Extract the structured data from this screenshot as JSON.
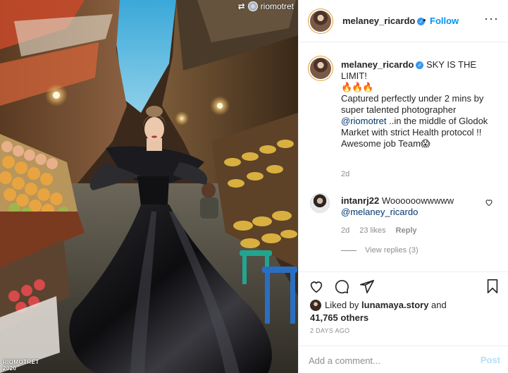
{
  "photo": {
    "repost_handle": "riomotret",
    "watermark_line1": "RIOMOTRET",
    "watermark_line2": "2020"
  },
  "header": {
    "username": "melaney_ricardo",
    "verified_glyph": "✓",
    "separator": "•",
    "follow_label": "Follow",
    "more_glyph": "···"
  },
  "caption": {
    "username": "melaney_ricardo",
    "headline": "SKY IS THE LIMIT!",
    "emoji": "🔥🔥🔥",
    "body1": "Captured perfectly under 2 mins by super talented photographer",
    "mention": "@riomotret",
    "body2": " ..in the middle of Glodok Market with strict Health protocol !!",
    "closing": "Awesome job Team😱",
    "time": "2d"
  },
  "comment": {
    "username": "intanrj22",
    "text": "Woooooowwwww",
    "mention": "@melaney_ricardo",
    "time": "2d",
    "likes": "23 likes",
    "reply_label": "Reply",
    "view_replies": "View replies (3)"
  },
  "likes": {
    "prefix": "Liked by",
    "liker": "lunamaya.story",
    "joiner": "and",
    "count_text": "41,765 others"
  },
  "post_date": "2 DAYS AGO",
  "add_comment": {
    "placeholder": "Add a comment...",
    "post_label": "Post"
  },
  "icons": [
    "repost-icon",
    "verified-icon",
    "heart-icon",
    "comment-icon",
    "share-icon",
    "bookmark-icon",
    "more-icon"
  ],
  "colors": {
    "accent": "#0095f6",
    "verified": "#3897f0",
    "muted": "#8e8e8e",
    "post_disabled": "#b2dffc"
  }
}
